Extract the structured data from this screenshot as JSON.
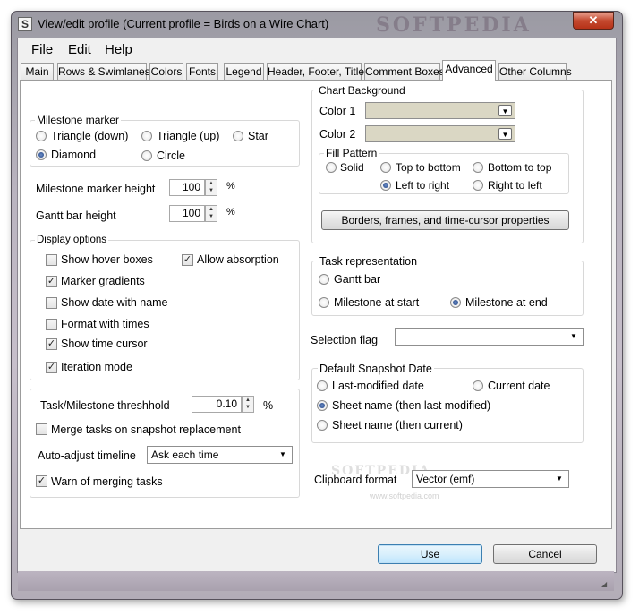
{
  "window": {
    "title": "View/edit profile (Current profile = Birds on a Wire Chart)",
    "watermark": "SOFTPEDIA",
    "close_glyph": "✕",
    "app_icon": "S"
  },
  "menu": {
    "file": "File",
    "edit": "Edit",
    "help": "Help"
  },
  "tabs": [
    "Main",
    "Rows & Swimlanes",
    "Colors",
    "Fonts",
    "Legend",
    "Header, Footer, Title",
    "Comment Boxes",
    "Advanced",
    "Other Columns"
  ],
  "active_tab": "Advanced",
  "milestone_marker": {
    "label": "Milestone marker",
    "options": [
      "Triangle (down)",
      "Triangle (up)",
      "Star",
      "Diamond",
      "Circle"
    ],
    "selected": "Diamond"
  },
  "marker_height": {
    "label": "Milestone marker height",
    "value": "100",
    "unit": "%"
  },
  "gantt_height": {
    "label": "Gantt bar height",
    "value": "100",
    "unit": "%"
  },
  "display_options": {
    "label": "Display options",
    "items": [
      {
        "label": "Show hover boxes",
        "checked": false
      },
      {
        "label": "Allow absorption",
        "checked": true
      },
      {
        "label": "Marker gradients",
        "checked": true
      },
      {
        "label": "Show date with name",
        "checked": false
      },
      {
        "label": "Format with times",
        "checked": false
      },
      {
        "label": "Show time cursor",
        "checked": true
      },
      {
        "label": "Iteration mode",
        "checked": true
      }
    ]
  },
  "threshold": {
    "label": "Task/Milestone threshhold",
    "value": "0.10",
    "unit": "%"
  },
  "merge_tasks": {
    "label": "Merge tasks on snapshot replacement",
    "checked": false
  },
  "auto_adjust": {
    "label": "Auto-adjust timeline",
    "value": "Ask each time"
  },
  "warn_merge": {
    "label": "Warn of merging tasks",
    "checked": true
  },
  "chart_background": {
    "label": "Chart Background",
    "color1_label": "Color 1",
    "color2_label": "Color 2",
    "color1": "#dad7c4",
    "color2": "#dad7c4",
    "fill_pattern": {
      "label": "Fill Pattern",
      "options": [
        "Solid",
        "Top to bottom",
        "Bottom to top",
        "Left to right",
        "Right to left"
      ],
      "selected": "Left to right"
    },
    "borders_button": "Borders, frames, and time-cursor properties"
  },
  "task_representation": {
    "label": "Task representation",
    "options": [
      "Gantt bar",
      "Milestone at start",
      "Milestone at end"
    ],
    "selected": "Milestone at end"
  },
  "selection_flag": {
    "label": "Selection flag",
    "value": ""
  },
  "snapshot_date": {
    "label": "Default Snapshot Date",
    "options": [
      "Last-modified date",
      "Current date",
      "Sheet name (then last modified)",
      "Sheet name (then current)"
    ],
    "selected": "Sheet name (then last modified)"
  },
  "clipboard": {
    "label": "Clipboard format",
    "value": "Vector (emf)",
    "watermark": "SOFTPEDIA",
    "watermark_url": "www.softpedia.com"
  },
  "buttons": {
    "use": "Use",
    "cancel": "Cancel"
  }
}
